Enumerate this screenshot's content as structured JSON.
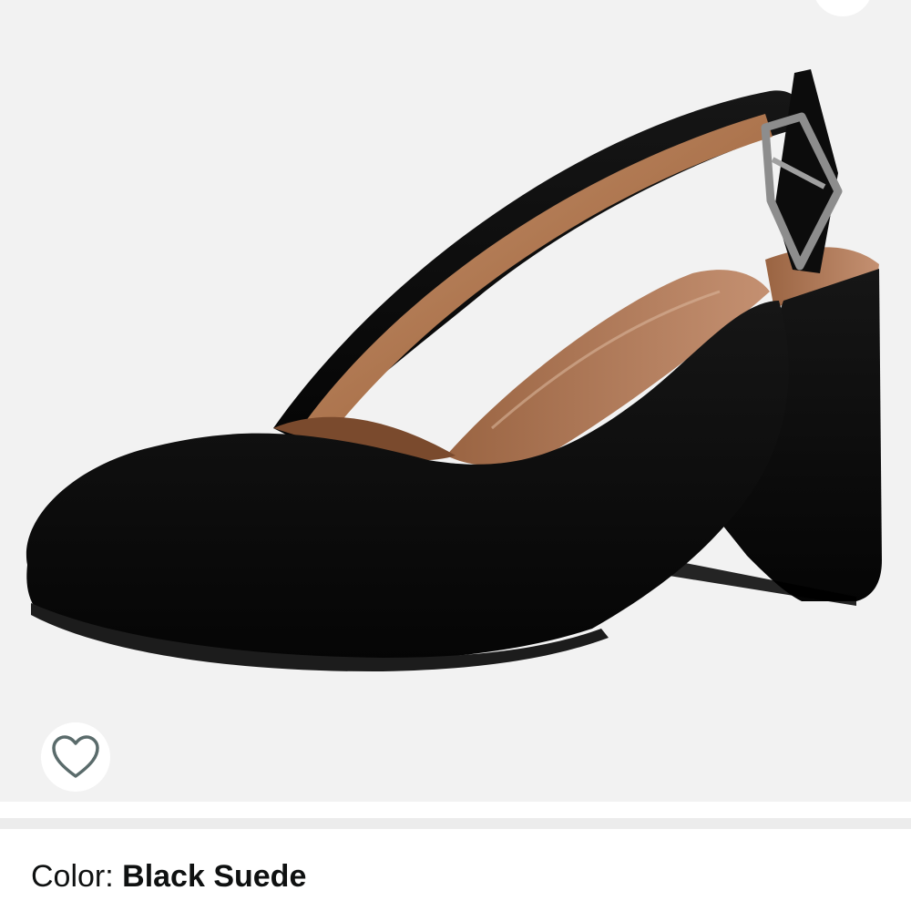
{
  "product": {
    "image_description_icon": "product-image",
    "color_label": "Color: ",
    "color_value": "Black Suede"
  },
  "actions": {
    "wishlist_icon": "heart-outline-icon",
    "share_icon": "share-icon"
  },
  "colors": {
    "image_background": "#f2f2f2",
    "suede": "#0b0b0b",
    "lining": "#b07a55",
    "icon": "#5a6b6b"
  }
}
